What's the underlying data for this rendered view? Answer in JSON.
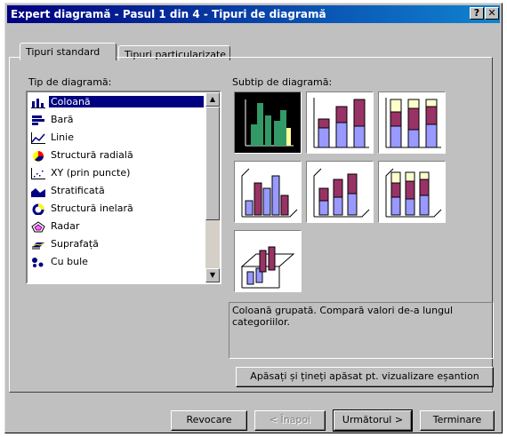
{
  "window": {
    "title": "Expert diagramă - Pasul 1 din 4 - Tipuri de diagramă",
    "help_glyph": "?",
    "close_glyph": "✕"
  },
  "tabs": [
    {
      "label": "Tipuri standard",
      "active": true
    },
    {
      "label": "Tipuri particularizate",
      "active": false
    }
  ],
  "chart_type_label": "Tip de diagramă:",
  "chart_types": [
    {
      "label": "Coloană",
      "icon": "column-chart-icon",
      "selected": true
    },
    {
      "label": "Bară",
      "icon": "bar-chart-icon"
    },
    {
      "label": "Linie",
      "icon": "line-chart-icon"
    },
    {
      "label": "Structură radială",
      "icon": "pie-chart-icon"
    },
    {
      "label": "XY (prin puncte)",
      "icon": "scatter-chart-icon"
    },
    {
      "label": "Stratificată",
      "icon": "area-chart-icon"
    },
    {
      "label": "Structură inelară",
      "icon": "doughnut-chart-icon"
    },
    {
      "label": "Radar",
      "icon": "radar-chart-icon"
    },
    {
      "label": "Suprafață",
      "icon": "surface-chart-icon"
    },
    {
      "label": "Cu bule",
      "icon": "bubble-chart-icon"
    }
  ],
  "subtype_label": "Subtip de diagramă:",
  "subtypes": [
    {
      "name": "clustered-column",
      "selected": true
    },
    {
      "name": "stacked-column"
    },
    {
      "name": "100-stacked-column"
    },
    {
      "name": "3d-clustered-column"
    },
    {
      "name": "3d-stacked-column"
    },
    {
      "name": "3d-100-stacked-column"
    },
    {
      "name": "3d-column"
    }
  ],
  "description": "Coloană grupată. Compară valori de-a lungul categoriilor.",
  "preview_button": "Apăsați și țineți apăsat pt. vizualizare eșantion",
  "buttons": {
    "cancel": "Revocare",
    "back": "< Înapoi",
    "next": "Următorul >",
    "finish": "Terminare"
  },
  "colors": {
    "title_bar": "#000080",
    "selection": "#000080",
    "series_a": "#9999ff",
    "series_b": "#993366",
    "series_c": "#ffffcc",
    "selected_green": "#339966"
  }
}
